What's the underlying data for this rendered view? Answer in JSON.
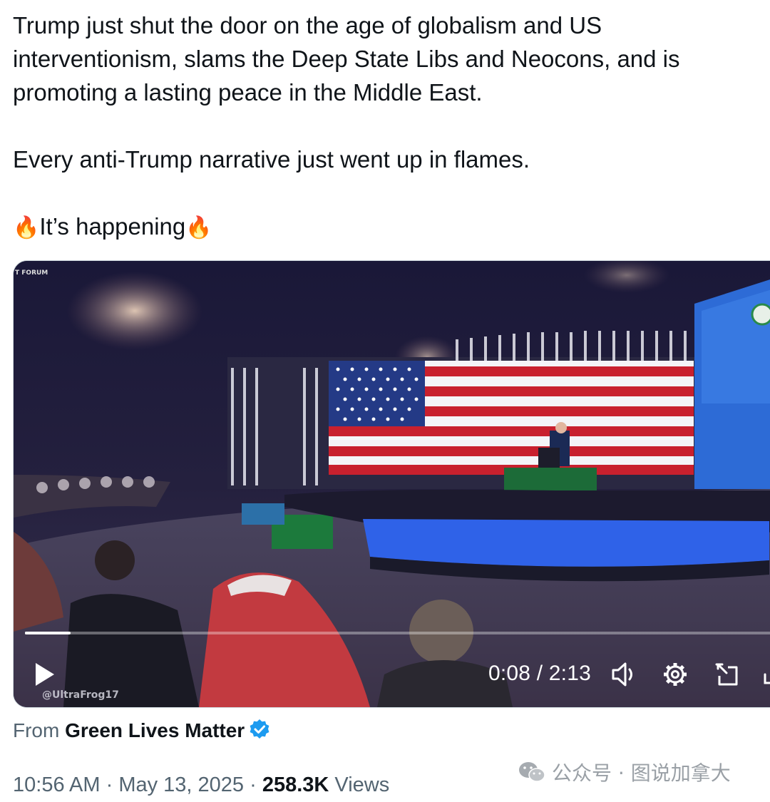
{
  "tweet": {
    "line1": "Trump just shut the door on the age of globalism and US interventionism, slams the Deep State Libs and Neocons, and is promoting a lasting peace in the Middle East.",
    "line2": "Every anti-Trump narrative just went up in flames.",
    "line3_emoji_left": "🔥",
    "line3_text": "It’s happening",
    "line3_emoji_right": "🔥"
  },
  "video": {
    "time_display": "0:08 / 2:13",
    "progress_fraction": 0.06,
    "watermark_handle": "@UltraFrog17",
    "corner_tag": "T FORUM",
    "icons": [
      "play-icon",
      "volume-icon",
      "settings-icon",
      "picture-in-picture-icon",
      "fullscreen-icon"
    ]
  },
  "attribution": {
    "from_label": "From",
    "author": "Green Lives Matter",
    "verified_color": "#1d9bf0"
  },
  "meta": {
    "time": "10:56 AM",
    "sep1": " · ",
    "date": "May 13, 2025",
    "sep2": " · ",
    "views_count": "258.3K",
    "views_label": " Views"
  },
  "overlay_watermark": {
    "text": "公众号 · 图说加拿大"
  }
}
